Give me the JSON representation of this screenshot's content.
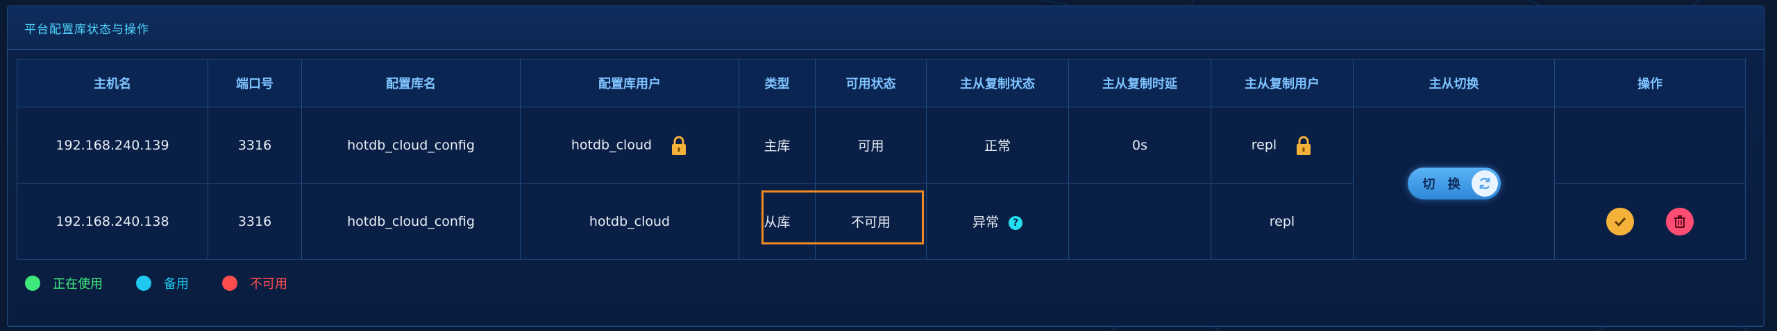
{
  "panel": {
    "title": "平台配置库状态与操作"
  },
  "table": {
    "headers": [
      "主机名",
      "端口号",
      "配置库名",
      "配置库用户",
      "类型",
      "可用状态",
      "主从复制状态",
      "主从复制时延",
      "主从复制用户",
      "主从切换",
      "操作"
    ],
    "rows": [
      {
        "host": "192.168.240.139",
        "port": "3316",
        "db_name": "hotdb_cloud_config",
        "db_user": "hotdb_cloud",
        "type": "主库",
        "status": "可用",
        "repl_status": "正常",
        "repl_delay": "0s",
        "repl_user": "repl"
      },
      {
        "host": "192.168.240.138",
        "port": "3316",
        "db_name": "hotdb_cloud_config",
        "db_user": "hotdb_cloud",
        "type": "从库",
        "status": "不可用",
        "repl_status": "异常",
        "repl_delay": "",
        "repl_user": "repl"
      }
    ],
    "switch_label": "切 换"
  },
  "legend": [
    {
      "label": "正在使用",
      "color": "#3ee87a"
    },
    {
      "label": "备用",
      "color": "#1ec8f0"
    },
    {
      "label": "不可用",
      "color": "#ff4d4d"
    }
  ],
  "colors": {
    "accent": "#4fd6ff",
    "highlight": "#f08a24",
    "ok": "#3ee28a",
    "error": "#ff4d4d"
  }
}
